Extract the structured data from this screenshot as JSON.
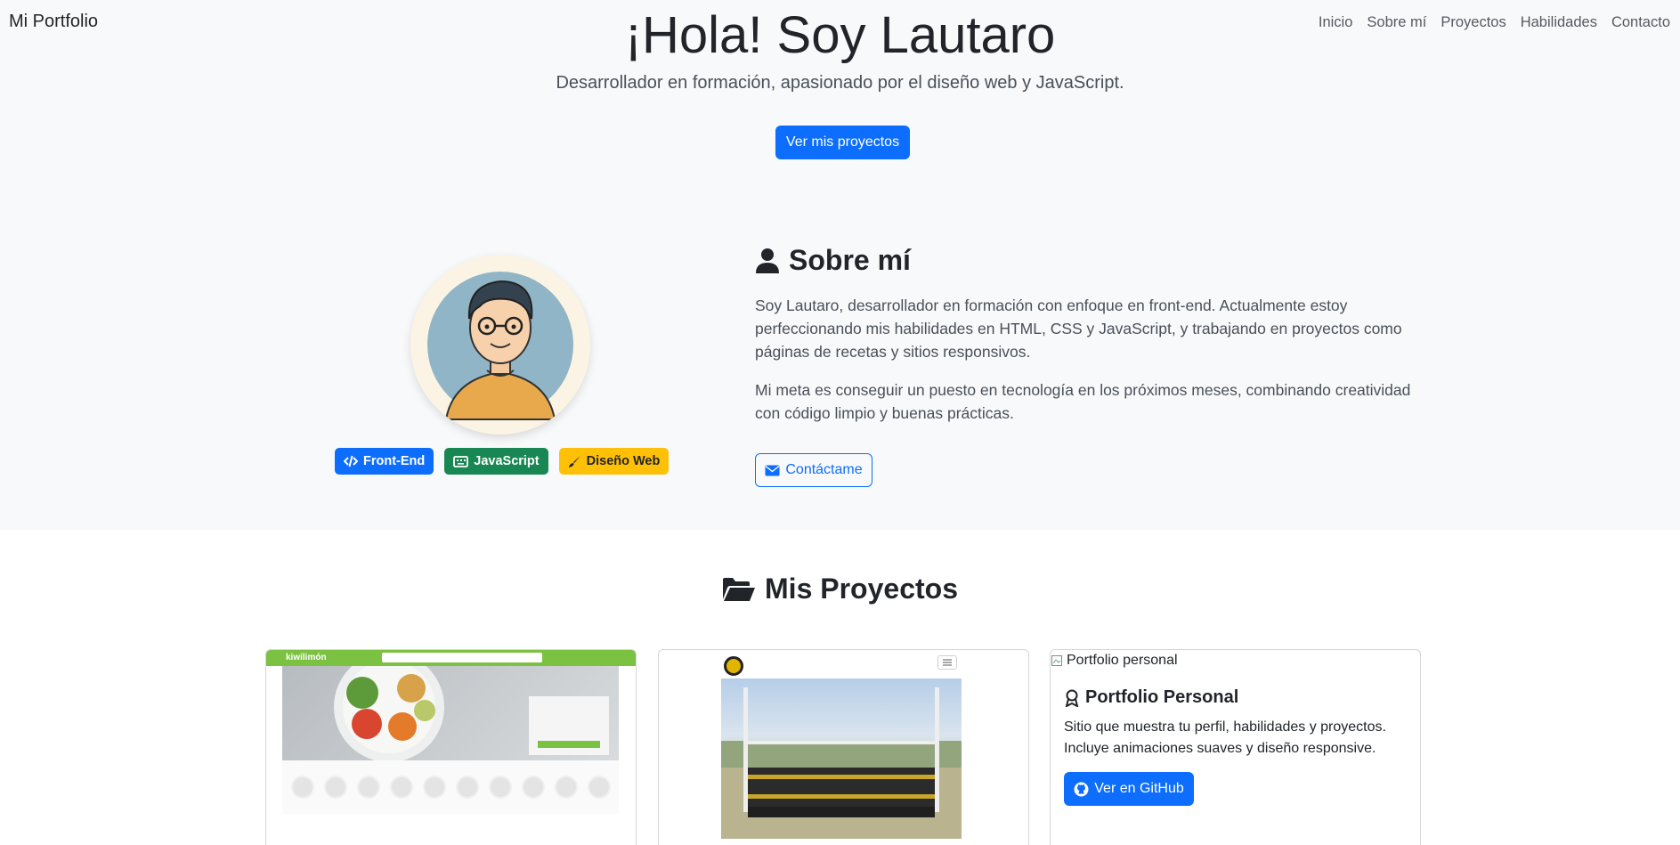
{
  "nav": {
    "brand": "Mi Portfolio",
    "links": [
      "Inicio",
      "Sobre mí",
      "Proyectos",
      "Habilidades",
      "Contacto"
    ]
  },
  "hero": {
    "title": "¡Hola! Soy Lautaro",
    "subtitle": "Desarrollador en formación, apasionado por el diseño web y JavaScript.",
    "cta_label": "Ver mis proyectos"
  },
  "about": {
    "title": "Sobre mí",
    "paragraph_1": "Soy Lautaro, desarrollador en formación con enfoque en front-end. Actualmente estoy perfeccionando mis habilidades en HTML, CSS y JavaScript, y trabajando en proyectos como páginas de recetas y sitios responsivos.",
    "paragraph_2": "Mi meta es conseguir un puesto en tecnología en los próximos meses, combinando creatividad con código limpio y buenas prácticas.",
    "contact_label": "Contáctame",
    "badges": [
      {
        "label": "Front-End",
        "icon": "code-icon",
        "color": "#0d6efd"
      },
      {
        "label": "JavaScript",
        "icon": "keyboard-icon",
        "color": "#198754"
      },
      {
        "label": "Diseño Web",
        "icon": "brush-icon",
        "color": "#ffc107"
      }
    ]
  },
  "projects": {
    "title": "Mis Proyectos",
    "cards": [
      {
        "preview": "recipe-site-screenshot",
        "preview_logo": "kiwilimón"
      },
      {
        "preview": "rugby-team-photo-screenshot"
      },
      {
        "image_alt": "Portfolio personal",
        "title": "Portfolio Personal",
        "text": "Sitio que muestra tu perfil, habilidades y proyectos. Incluye animaciones suaves y diseño responsive.",
        "button_label": "Ver en GitHub"
      }
    ]
  },
  "colors": {
    "primary": "#0d6efd",
    "success": "#198754",
    "warning": "#ffc107",
    "hero_background": "#f8f9fa"
  }
}
